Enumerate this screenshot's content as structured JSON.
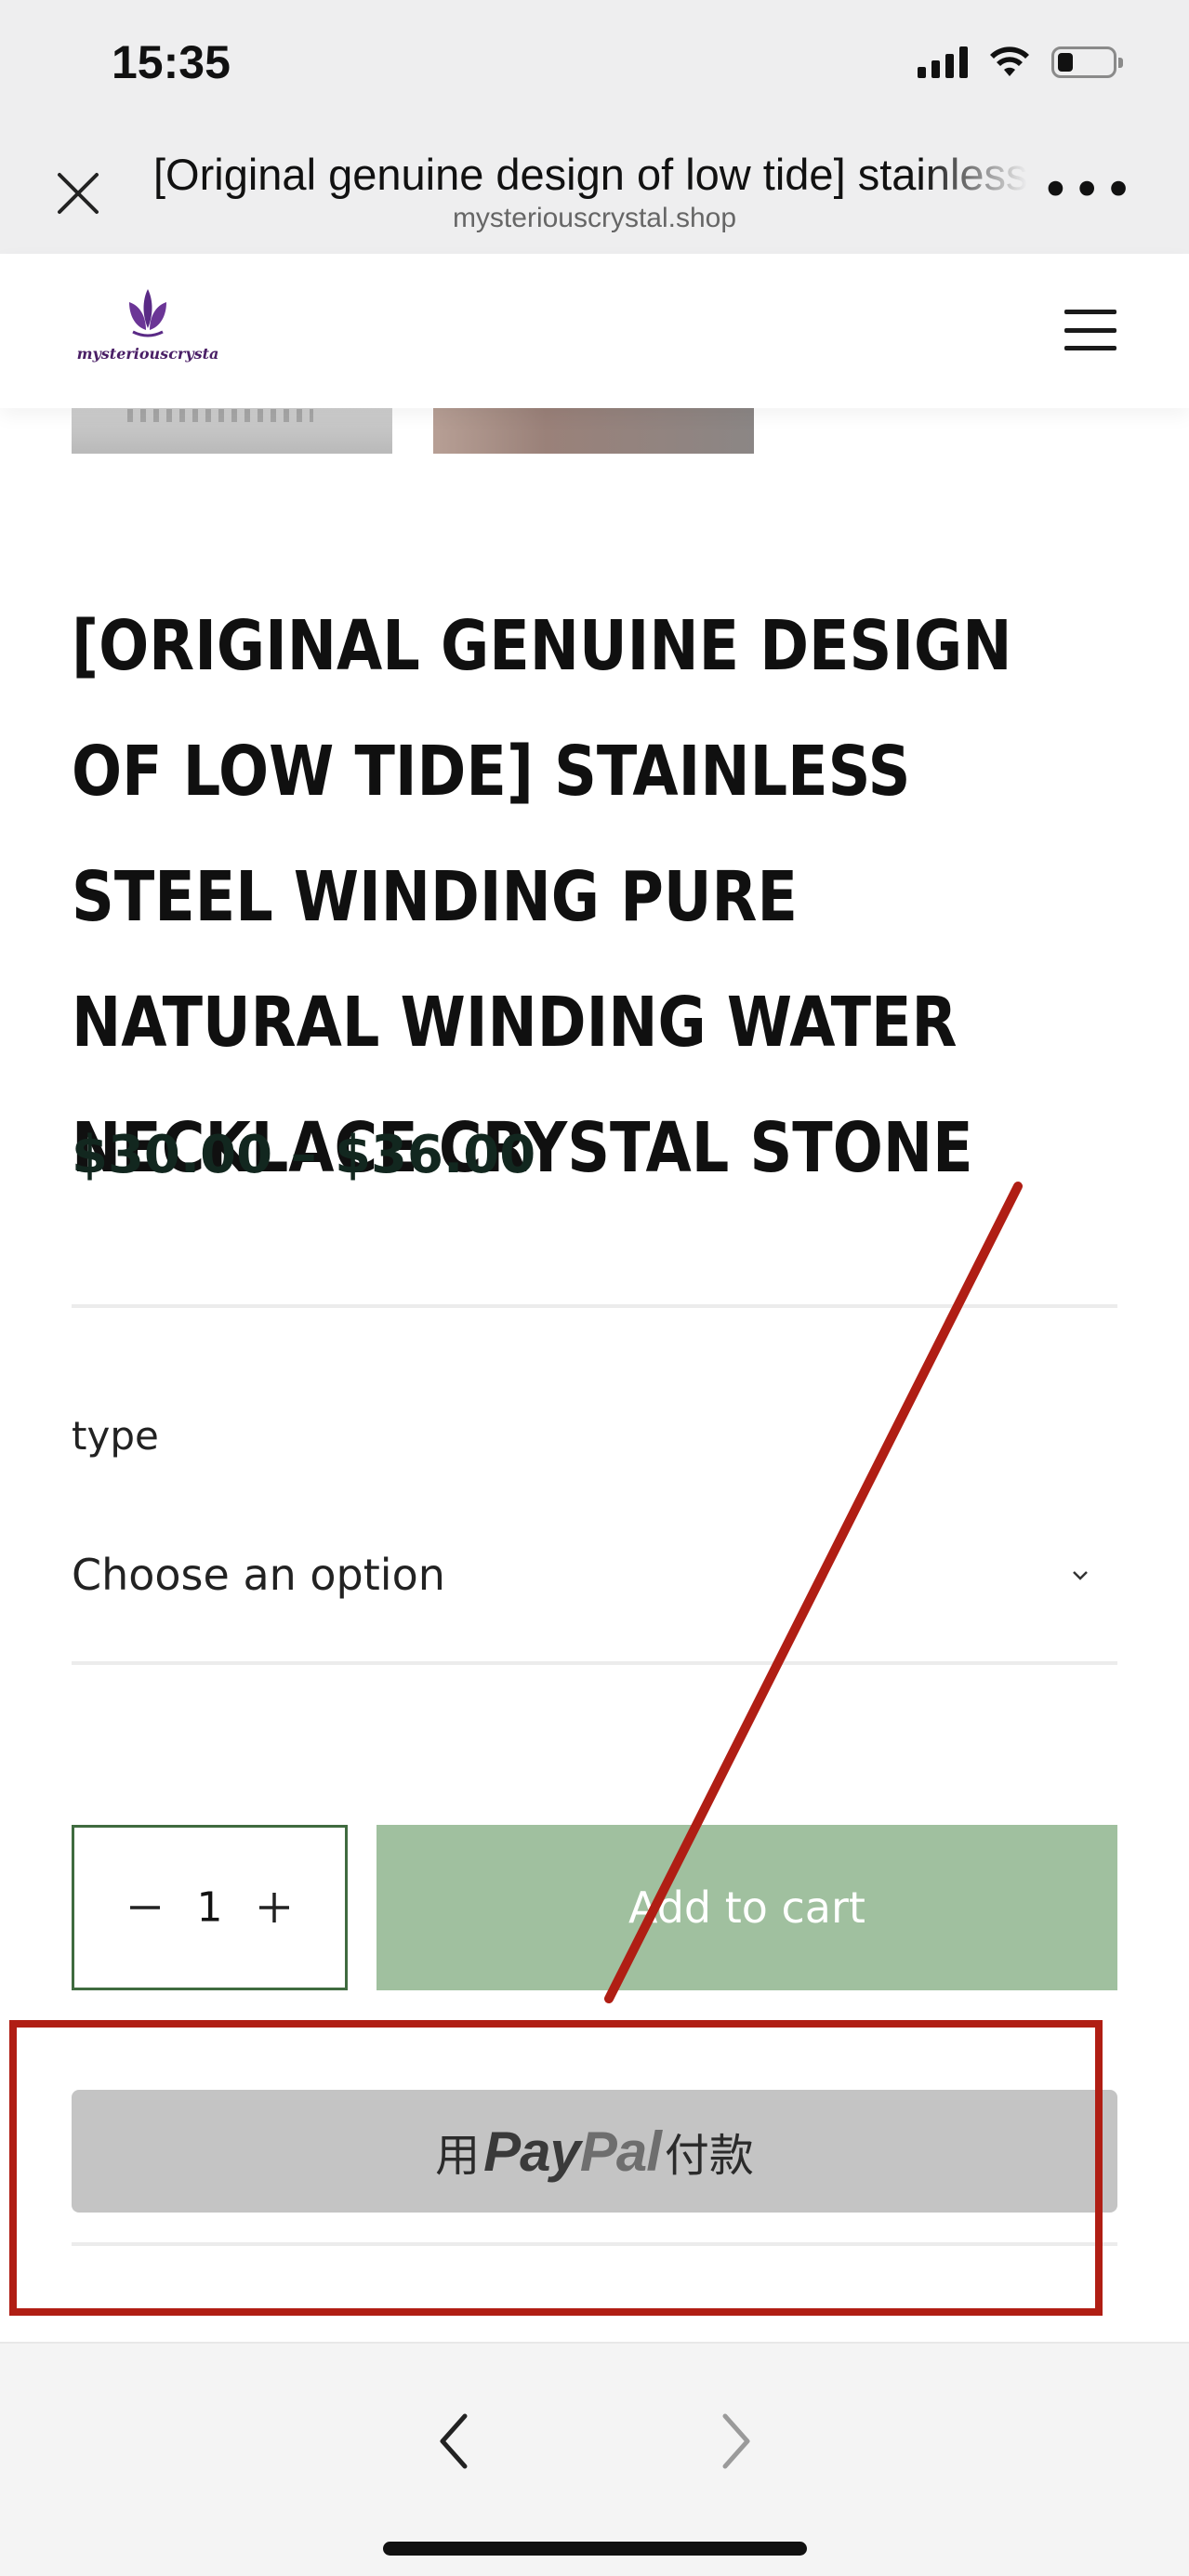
{
  "status_bar": {
    "time": "15:35"
  },
  "browser": {
    "title": "[Original genuine design of low tide] stainless steel winding pure natural winding water necklace crystal stone",
    "domain": "mysteriouscrystal.shop",
    "more_label": "•••"
  },
  "site": {
    "logo_text": "mysteriouscrysta"
  },
  "product": {
    "title": "[Original genuine design of low tide] stainless steel winding pure natural winding water necklace crystal stone",
    "price": "$30.00 – $36.00",
    "type_label": "type",
    "select_value": "Choose an option",
    "quantity": "1",
    "add_to_cart_label": "Add to cart",
    "paypal": {
      "prefix": "用",
      "logo_pay": "Pay",
      "logo_pal": "Pal",
      "suffix": "付款"
    }
  },
  "colors": {
    "add_to_cart_bg": "#a0c09f",
    "paypal_bg": "#c4c4c4",
    "annotation_red": "#b01e14",
    "price_color": "#12271f"
  },
  "icons": {
    "close": "close-icon",
    "more": "more-icon",
    "menu": "hamburger-icon",
    "chevron": "chevron-down-icon",
    "minus": "minus-icon",
    "plus": "plus-icon",
    "back": "back-arrow-icon",
    "forward": "forward-arrow-icon"
  }
}
